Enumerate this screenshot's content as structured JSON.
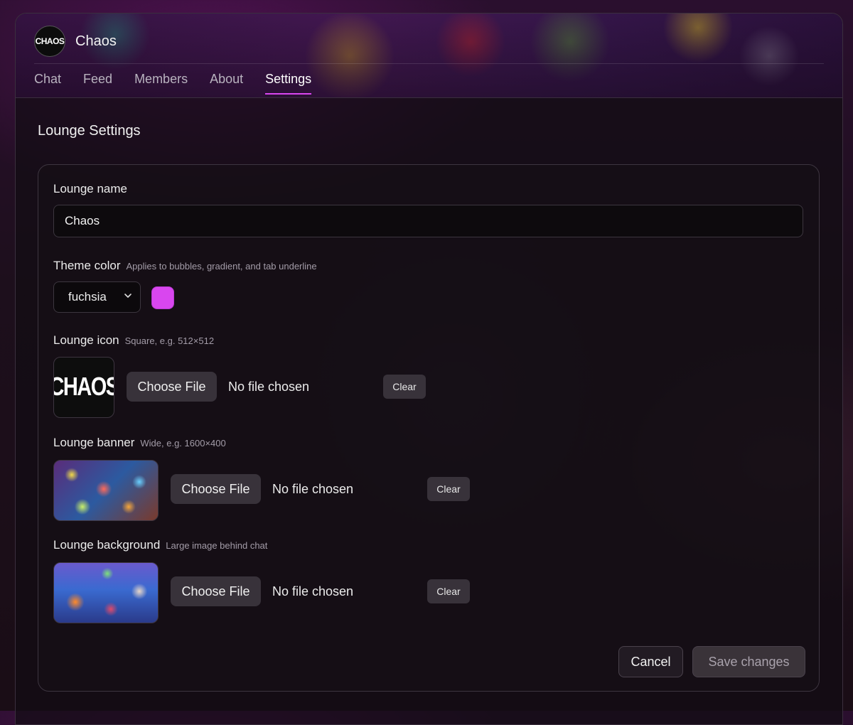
{
  "app": {
    "logo_text": "CHAOS",
    "title": "Chaos",
    "tabs": [
      {
        "label": "Chat"
      },
      {
        "label": "Feed"
      },
      {
        "label": "Members"
      },
      {
        "label": "About"
      },
      {
        "label": "Settings",
        "active": true
      }
    ]
  },
  "settings": {
    "title": "Lounge Settings",
    "name": {
      "label": "Lounge name",
      "value": "Chaos"
    },
    "theme": {
      "label": "Theme color",
      "hint": "Applies to bubbles, gradient, and tab underline",
      "selected": "fuchsia",
      "swatch_color": "#d946ef"
    },
    "icon": {
      "label": "Lounge icon",
      "hint": "Square, e.g. 512×512",
      "preview_text": "CHAOS",
      "choose_label": "Choose File",
      "status": "No file chosen",
      "clear_label": "Clear"
    },
    "banner": {
      "label": "Lounge banner",
      "hint": "Wide, e.g. 1600×400",
      "choose_label": "Choose File",
      "status": "No file chosen",
      "clear_label": "Clear"
    },
    "background": {
      "label": "Lounge background",
      "hint": "Large image behind chat",
      "choose_label": "Choose File",
      "status": "No file chosen",
      "clear_label": "Clear"
    },
    "cancel_label": "Cancel",
    "save_label": "Save changes"
  },
  "colors": {
    "accent": "#d946ef"
  }
}
